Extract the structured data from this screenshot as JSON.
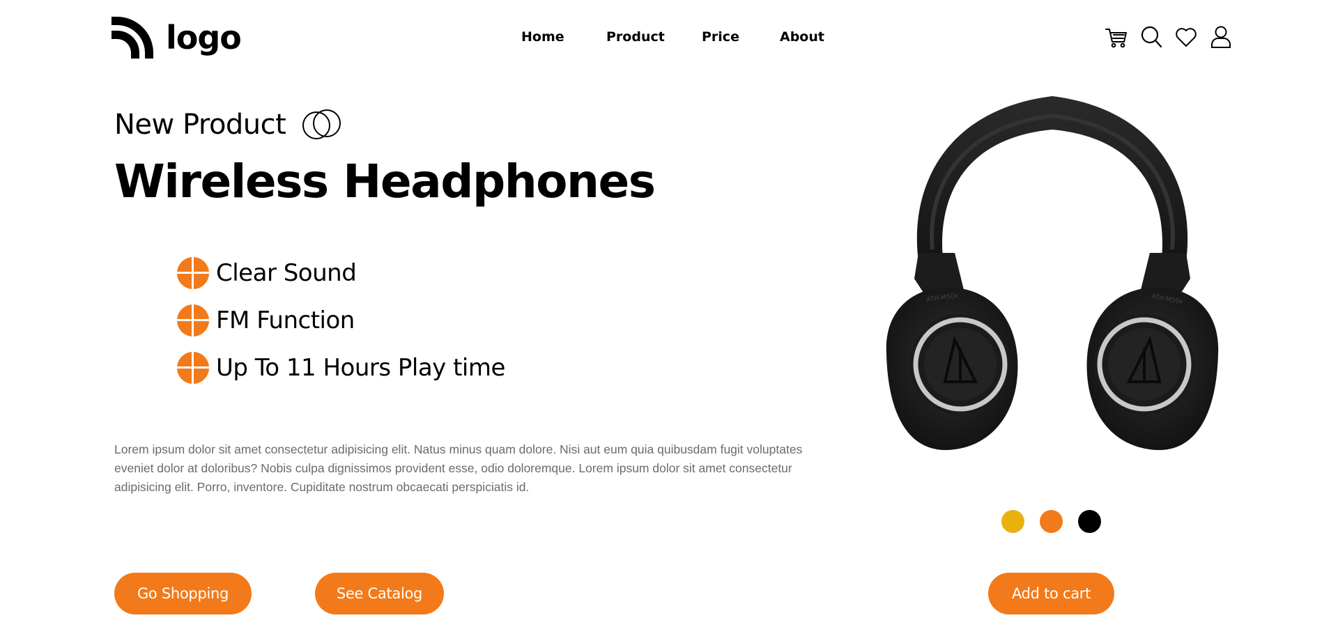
{
  "header": {
    "logo_text": "logo",
    "nav": [
      {
        "label": "Home"
      },
      {
        "label": "Product"
      },
      {
        "label": "Price"
      },
      {
        "label": "About"
      }
    ],
    "icons": [
      "cart-icon",
      "search-icon",
      "heart-icon",
      "user-icon"
    ]
  },
  "hero": {
    "eyebrow": "New Product",
    "title": "Wireless Headphones",
    "features": [
      {
        "label": "Clear Sound"
      },
      {
        "label": "FM Function"
      },
      {
        "label": "Up To 11 Hours Play time"
      }
    ],
    "description": "Lorem ipsum dolor sit amet consectetur adipisicing elit. Natus minus quam dolore. Nisi aut eum quia quibusdam fugit voluptates eveniet dolor at doloribus? Nobis culpa dignissimos provident esse, odio doloremque. Lorem ipsum dolor sit amet consectetur adipisicing elit. Porro, inventore. Cupiditate nostrum obcaecati perspiciatis id.",
    "buttons": {
      "shop": "Go Shopping",
      "catalog": "See Catalog"
    }
  },
  "product": {
    "swatches": [
      {
        "color": "#e8b10e"
      },
      {
        "color": "#f27a1a"
      },
      {
        "color": "#000000"
      }
    ],
    "add_to_cart": "Add to cart",
    "earcup_marking": "ATH-M50x"
  },
  "colors": {
    "accent": "#f27a1a",
    "text": "#000000",
    "muted": "#6b6b6b"
  }
}
